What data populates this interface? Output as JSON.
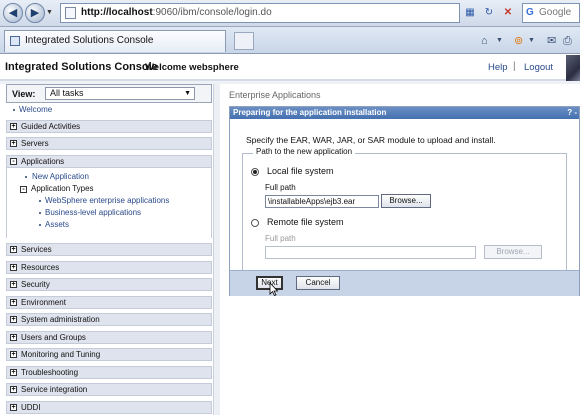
{
  "browser": {
    "url_host": "http://localhost",
    "url_rest": ":9060/ibm/console/login.do",
    "search_placeholder": "Google",
    "tab_title": "Integrated Solutions Console"
  },
  "header": {
    "app_title": "Integrated Solutions Console",
    "welcome": "Welcome websphere",
    "help": "Help",
    "separator": "|",
    "logout": "Logout"
  },
  "nav": {
    "view_label": "View:",
    "view_value": "All tasks",
    "welcome": "Welcome",
    "sections": [
      {
        "label": "Guided Activities",
        "state": "+"
      },
      {
        "label": "Servers",
        "state": "+"
      },
      {
        "label": "Applications",
        "state": "-"
      },
      {
        "label": "Services",
        "state": "+"
      },
      {
        "label": "Resources",
        "state": "+"
      },
      {
        "label": "Security",
        "state": "+"
      },
      {
        "label": "Environment",
        "state": "+"
      },
      {
        "label": "System administration",
        "state": "+"
      },
      {
        "label": "Users and Groups",
        "state": "+"
      },
      {
        "label": "Monitoring and Tuning",
        "state": "+"
      },
      {
        "label": "Troubleshooting",
        "state": "+"
      },
      {
        "label": "Service integration",
        "state": "+"
      },
      {
        "label": "UDDI",
        "state": "+"
      }
    ],
    "applications": {
      "new_application": "New Application",
      "types_label": "Application Types",
      "types_state": "-",
      "types": [
        "WebSphere enterprise applications",
        "Business-level applications",
        "Assets"
      ]
    }
  },
  "content": {
    "breadcrumb": "Enterprise Applications",
    "panel_title": "Preparing for the application installation",
    "panel_icons": "? -",
    "description": "Specify the EAR, WAR, JAR, or SAR module to upload and install.",
    "fieldset_legend": "Path to the new application",
    "local": {
      "label": "Local file system",
      "selected": true,
      "full_path_label": "Full path",
      "full_path_value": "\\installableApps\\ejb3.ear",
      "browse": "Browse..."
    },
    "remote": {
      "label": "Remote file system",
      "selected": false,
      "full_path_label": "Full path",
      "full_path_value": "",
      "browse": "Browse..."
    },
    "buttons": {
      "next": "Next",
      "cancel": "Cancel"
    }
  }
}
